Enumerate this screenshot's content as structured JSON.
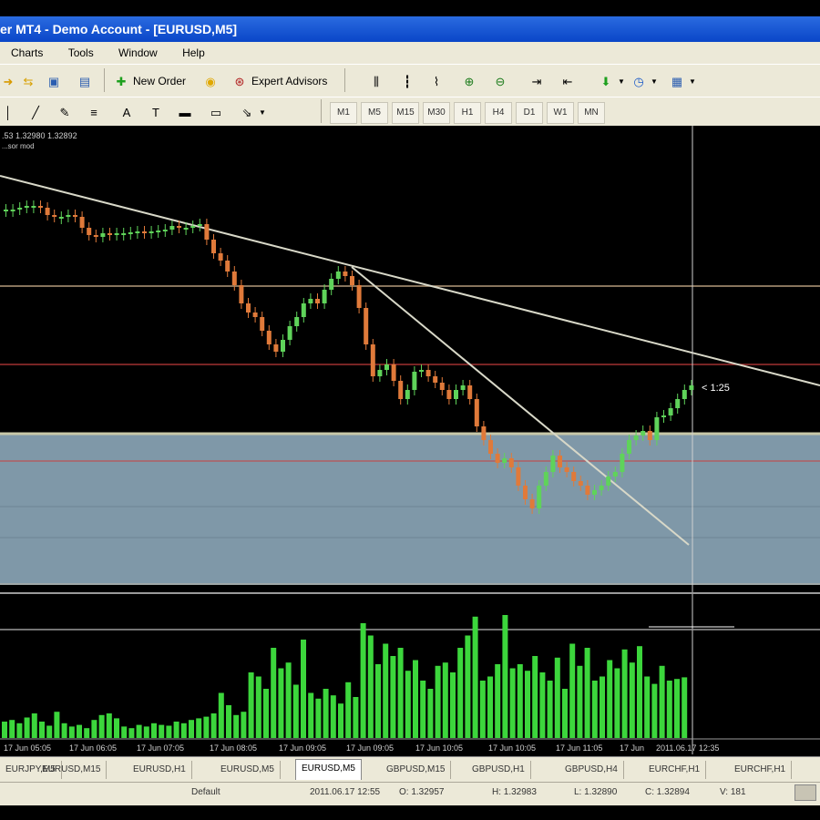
{
  "window": {
    "title": "er MT4 - Demo Account - [EURUSD,M5]"
  },
  "menu": [
    "Charts",
    "Tools",
    "Window",
    "Help"
  ],
  "toolbar": {
    "new_order_label": "New Order",
    "expert_advisors_label": "Expert Advisors",
    "timeframes": [
      "M1",
      "M5",
      "M15",
      "M30",
      "H1",
      "H4",
      "D1",
      "W1",
      "MN"
    ]
  },
  "chart": {
    "symbol_info": ".53 1.32980 1.32892",
    "info_line2": "...sor mod",
    "timer_label": "< 1:25",
    "time_labels": [
      "17 Jun 05:05",
      "17 Jun 06:05",
      "17 Jun 07:05",
      "17 Jun 08:05",
      "17 Jun 09:05",
      "17 Jun 09:05",
      "17 Jun 10:05",
      "17 Jun 10:05",
      "17 Jun 11:05",
      "17 Jun",
      "2011.06.17 12:35"
    ]
  },
  "colors": {
    "bull": "#5fd35a",
    "bear": "#e07a3a",
    "trendline": "#d8d8c8",
    "zone": "#7f98a8",
    "volume": "#3cd63c",
    "red_line": "#c03030",
    "tan_line": "#b49a7a"
  },
  "tabs": [
    "EURJPY,M5",
    "EURUSD,M15",
    "EURUSD,H1",
    "EURUSD,M5",
    "EURUSD,M5",
    "GBPUSD,M15",
    "GBPUSD,H1",
    "GBPUSD,H4",
    "EURCHF,H1",
    "EURCHF,H1"
  ],
  "active_tab_index": 4,
  "status": {
    "profile": "Default",
    "datetime": "2011.06.17 12:55",
    "open": "O: 1.32957",
    "high": "H: 1.32983",
    "low": "L: 1.32890",
    "close": "C: 1.32894",
    "volume": "V: 181"
  }
}
